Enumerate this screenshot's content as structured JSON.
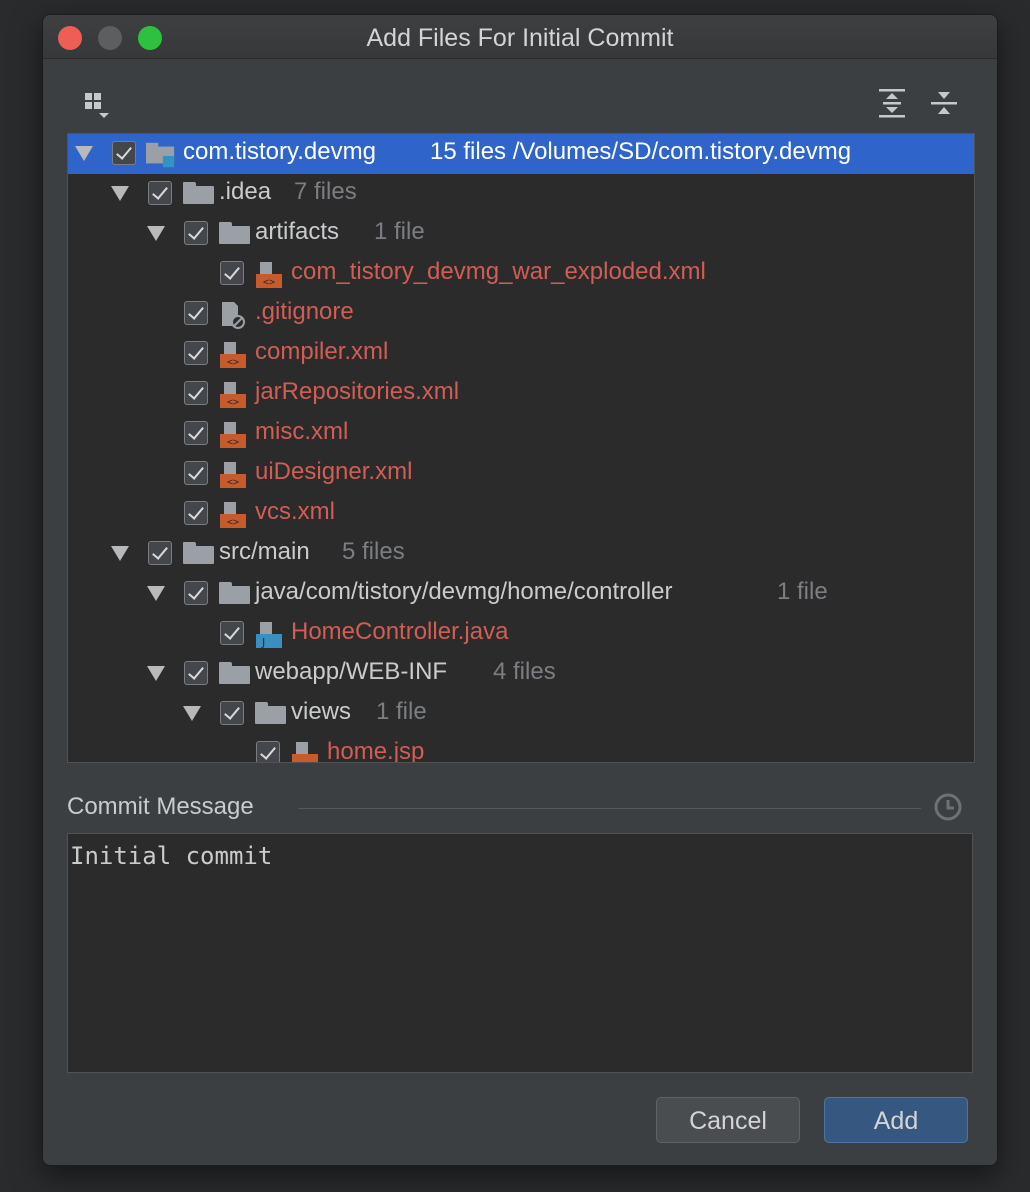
{
  "window": {
    "title": "Add Files For Initial Commit"
  },
  "toolbar": {
    "group_by_icon": "group-by-icon",
    "expand_all_icon": "expand-all-icon",
    "collapse_all_icon": "collapse-all-icon"
  },
  "tree": {
    "rows": [
      {
        "label": "com.tistory.devmg",
        "count": "15 files  /Volumes/SD/com.tistory.devmg",
        "type": "module-folder",
        "checked": true,
        "expanded": true,
        "selected": true
      },
      {
        "label": ".idea",
        "count": "7 files",
        "type": "folder",
        "checked": true,
        "expanded": true
      },
      {
        "label": "artifacts",
        "count": "1 file",
        "type": "folder",
        "checked": true,
        "expanded": true
      },
      {
        "label": "com_tistory_devmg_war_exploded.xml",
        "count": "",
        "type": "xml-file",
        "checked": true,
        "status": "unversioned"
      },
      {
        "label": ".gitignore",
        "count": "",
        "type": "ignore-file",
        "checked": true,
        "status": "unversioned"
      },
      {
        "label": "compiler.xml",
        "count": "",
        "type": "xml-file",
        "checked": true,
        "status": "unversioned"
      },
      {
        "label": "jarRepositories.xml",
        "count": "",
        "type": "xml-file",
        "checked": true,
        "status": "unversioned"
      },
      {
        "label": "misc.xml",
        "count": "",
        "type": "xml-file",
        "checked": true,
        "status": "unversioned"
      },
      {
        "label": "uiDesigner.xml",
        "count": "",
        "type": "xml-file",
        "checked": true,
        "status": "unversioned"
      },
      {
        "label": "vcs.xml",
        "count": "",
        "type": "xml-file",
        "checked": true,
        "status": "unversioned"
      },
      {
        "label": "src/main",
        "count": "5 files",
        "type": "folder",
        "checked": true,
        "expanded": true
      },
      {
        "label": "java/com/tistory/devmg/home/controller",
        "count": "1 file",
        "type": "folder",
        "checked": true,
        "expanded": true
      },
      {
        "label": "HomeController.java",
        "count": "",
        "type": "java-file",
        "checked": true,
        "status": "unversioned"
      },
      {
        "label": "webapp/WEB-INF",
        "count": "4 files",
        "type": "folder",
        "checked": true,
        "expanded": true
      },
      {
        "label": "views",
        "count": "1 file",
        "type": "folder",
        "checked": true,
        "expanded": true
      },
      {
        "label": "home.jsp",
        "count": "",
        "type": "jsp-file",
        "checked": true,
        "status": "unversioned"
      }
    ]
  },
  "commit": {
    "label": "Commit Message",
    "message": "Initial commit",
    "history_icon": "history-icon"
  },
  "buttons": {
    "cancel": "Cancel",
    "add": "Add"
  },
  "colors": {
    "unversioned": "#d05e54",
    "selection": "#2f65ca",
    "background": "#3c3f41"
  }
}
